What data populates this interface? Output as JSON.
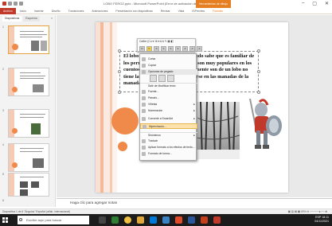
{
  "window": {
    "title": "LOBO FEROZ.pptx - Microsoft PowerPoint (Error de activación de productos)",
    "context_tab_group": "Herramientas de dibujo",
    "controls": [
      "–",
      "▢",
      "✕"
    ]
  },
  "ribbon": {
    "file_tab": "Archivo",
    "tabs": [
      "Inicio",
      "Insertar",
      "Diseño",
      "Transiciones",
      "Animaciones",
      "Presentación con diapositivas",
      "Revisar",
      "Vista",
      "ISPreview",
      "Formato"
    ]
  },
  "left_panel": {
    "tabs": [
      "Diapositivas",
      "Esquema"
    ],
    "close": "×",
    "slide_numbers": [
      "1",
      "2",
      "3",
      "4",
      "5",
      "6"
    ]
  },
  "slide": {
    "text": "El lobo feroz es algo que todo mundo sabe que es familiar de los perros y que son animales que son muy populares en los cuentos, bosques y siempre y solamente son de un lobo no tiene la exclusividad de reproducirse en las manadas de la manada"
  },
  "mini_toolbar": {
    "font": "Calibri (Cu",
    "size": "16",
    "row2": [
      "N",
      "K",
      "S",
      "≡",
      "≡",
      "≡",
      "A",
      "A",
      "A"
    ]
  },
  "context_menu": {
    "items": [
      {
        "label": "Cortar",
        "icon": "scissors-icon"
      },
      {
        "label": "Copiar",
        "icon": "copy-icon"
      },
      {
        "label": "Opciones de pegado:",
        "icon": "",
        "header": true
      },
      {
        "label": "Salir de Modificar texto",
        "icon": ""
      },
      {
        "label": "Fuente...",
        "icon": "font-icon"
      },
      {
        "label": "Párrafo...",
        "icon": "paragraph-icon"
      },
      {
        "label": "Viñetas",
        "icon": "bullets-icon",
        "arrow": true
      },
      {
        "label": "Numeración",
        "icon": "numbering-icon",
        "arrow": true
      },
      {
        "label": "Convertir a SmartArt",
        "icon": "smartart-icon",
        "arrow": true
      },
      {
        "label": "Hipervínculo...",
        "icon": "hyperlink-icon",
        "highlighted": true
      },
      {
        "label": "Sinónimos",
        "icon": "",
        "arrow": true
      },
      {
        "label": "Traducir",
        "icon": "translate-icon"
      },
      {
        "label": "Aplicar formato a los efectos de texto...",
        "icon": "text-effects-icon"
      },
      {
        "label": "Formato de forma...",
        "icon": "shape-format-icon"
      }
    ]
  },
  "notes": {
    "placeholder": "Haga clic para agregar notas"
  },
  "status_bar": {
    "left": "Diapositiva 1 de 6   \"Ángulos\"   Español (alfab. internacional)",
    "right": "▣ ▥ ▤ ▦   49%   ⊖ ─────●── ⊕"
  },
  "taskbar": {
    "search_placeholder": "Escribe aquí para buscar",
    "time": "18:11",
    "date": "04/11/2021",
    "lang": "ESP"
  },
  "colors": {
    "accent": "#c0392b",
    "orange": "#ef8a4a",
    "format_tab": "#e67e22",
    "highlight": "#fde3ab"
  }
}
